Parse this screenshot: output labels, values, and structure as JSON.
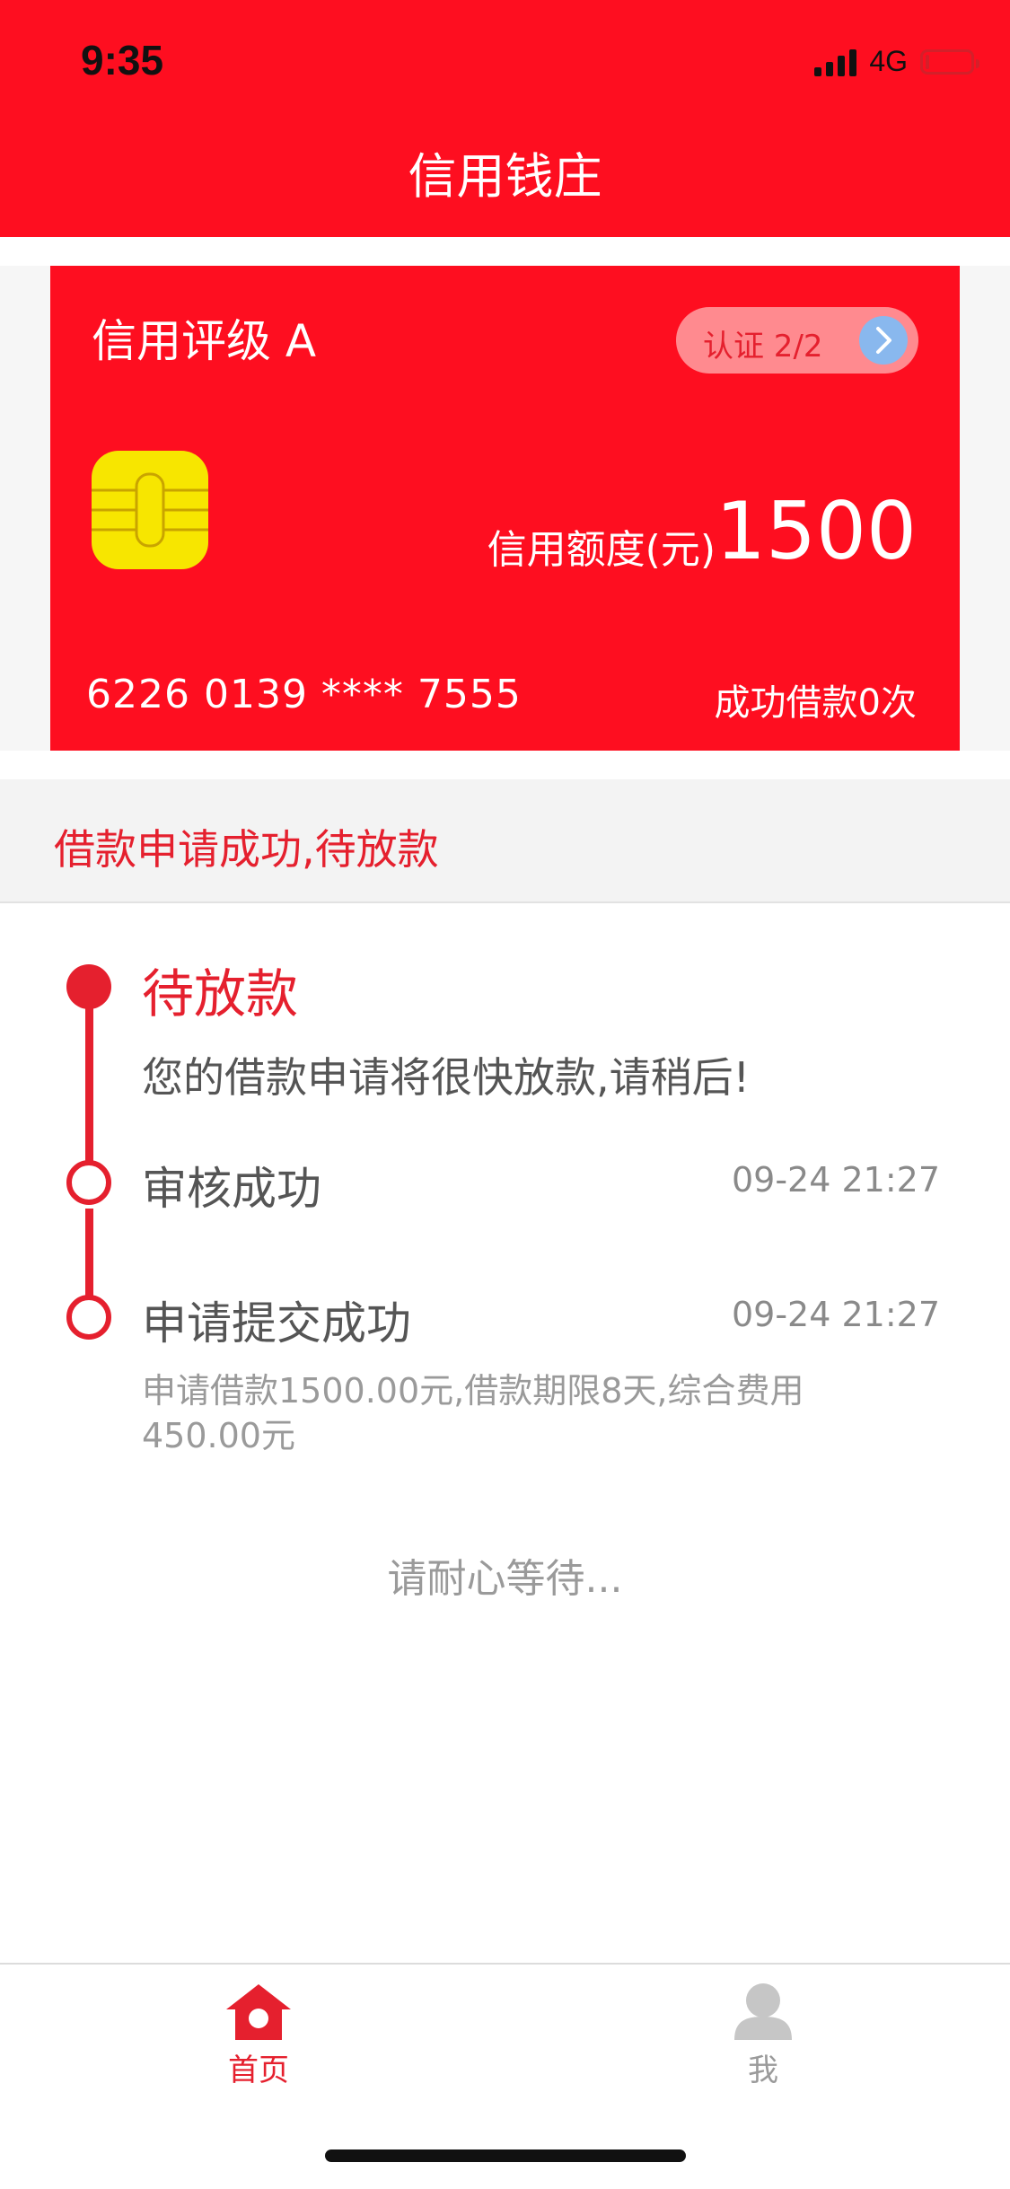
{
  "status_bar": {
    "time": "9:35",
    "network": "4G"
  },
  "header": {
    "title": "信用钱庄"
  },
  "card": {
    "rating": "信用评级 A",
    "cert_label": "认证 2/2",
    "limit_label": "信用额度(元)",
    "limit_value": "1500",
    "card_number": "6226 0139 **** 7555",
    "success_count": "成功借款0次"
  },
  "status": {
    "text": "借款申请成功,待放款"
  },
  "timeline": {
    "steps": [
      {
        "title": "待放款",
        "desc": "您的借款申请将很快放款,请稍后!"
      },
      {
        "title": "审核成功",
        "time": "09-24 21:27"
      },
      {
        "title": "申请提交成功",
        "time": "09-24 21:27",
        "desc": "申请借款1500.00元,借款期限8天,综合费用450.00元"
      }
    ]
  },
  "wait_text": "请耐心等待...",
  "tabbar": {
    "items": [
      {
        "label": "首页",
        "icon": "home-icon",
        "active": true
      },
      {
        "label": "我",
        "icon": "user-icon",
        "active": false
      }
    ]
  },
  "colors": {
    "brand": "#fe0e20",
    "accent": "#e5202e",
    "cert_bg": "#ff8a8f",
    "arrow_bg": "#89b8ee",
    "chip": "#f7e600"
  }
}
